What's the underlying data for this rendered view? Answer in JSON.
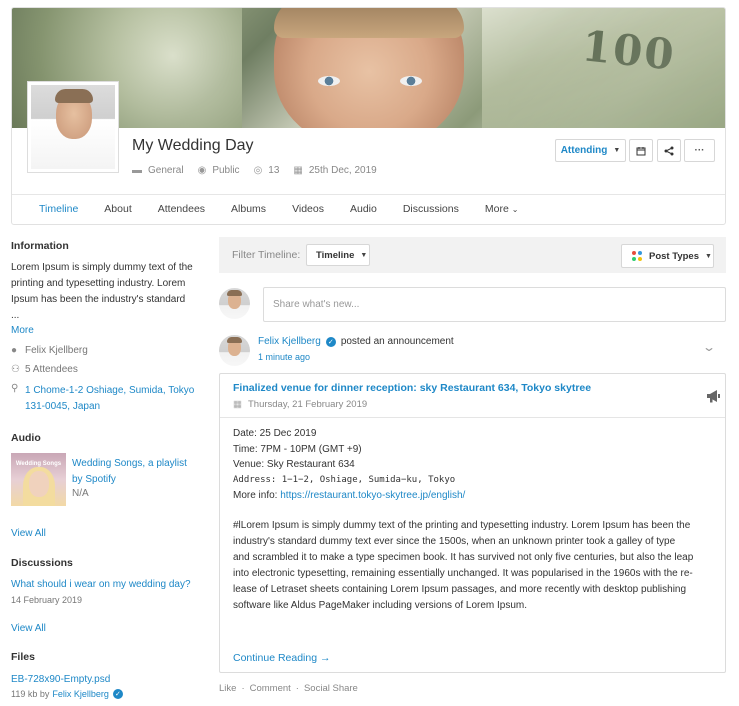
{
  "event": {
    "title": "My Wedding Day",
    "category": "General",
    "privacy": "Public",
    "views": "13",
    "date": "25th Dec, 2019"
  },
  "header_buttons": {
    "attending_label": "Attending",
    "more_label": "···"
  },
  "tabs": [
    "Timeline",
    "About",
    "Attendees",
    "Albums",
    "Videos",
    "Audio",
    "Discussions",
    "More"
  ],
  "sidebar": {
    "information": {
      "heading": "Information",
      "text_lines": [
        "Lorem Ipsum is simply dummy text of the",
        "printing and typesetting industry. Lorem",
        "Ipsum has been the industry's standard",
        "..."
      ],
      "more_link": "More",
      "host": "Felix Kjellberg",
      "attendees": "5 Attendees",
      "address_lines": [
        "1 Chome-1-2 Oshiage, Sumida, Tokyo",
        "131-0045, Japan"
      ]
    },
    "audio": {
      "heading": "Audio",
      "thumb_text": "Wedding Songs",
      "title_lines": [
        "Wedding Songs, a playlist",
        "by Spotify"
      ],
      "meta": "N/A",
      "view_all": "View All"
    },
    "discussions": {
      "heading": "Discussions",
      "title": "What should i wear on my wedding day?",
      "date": "14 February 2019",
      "view_all": "View All"
    },
    "files": {
      "heading": "Files",
      "file_name": "EB-728x90-Empty.psd",
      "meta_prefix": "119 kb by",
      "owner": "Felix Kjellberg"
    }
  },
  "filter": {
    "label": "Filter Timeline:",
    "selected": "Timeline",
    "post_types_label": "Post Types",
    "dot_colors": [
      "#e74c3c",
      "#3498db",
      "#2ecc71",
      "#f1c40f"
    ]
  },
  "composer": {
    "placeholder": "Share what's new..."
  },
  "post": {
    "author": "Felix Kjellberg",
    "action": "posted an announcement",
    "time": "1 minute ago",
    "announcement": {
      "title": "Finalized venue for dinner reception: sky Restaurant 634, Tokyo skytree",
      "date": "Thursday, 21 February 2019",
      "details": {
        "date_line": "Date: 25 Dec 2019",
        "time_line": "Time: 7PM - 10PM (GMT +9)",
        "venue_line": "Venue: Sky Restaurant 634",
        "address_line": "Address: 1−1−2, Oshiage, Sumida−ku, Tokyo",
        "more_info_prefix": "More info:",
        "more_info_link": "https://restaurant.tokyo-skytree.jp/english/"
      },
      "paragraph_lines": [
        "#lLorem Ipsum is simply dummy text of the printing and typesetting industry. Lorem Ipsum has been the",
        "industry's standard dummy text ever since the 1500s, when an unknown printer took a galley of type",
        "and scrambled it to make a type specimen book. It has survived not only five centuries, but also the leap",
        "into electronic typesetting, remaining essentially unchanged. It was popularised in the 1960s with the re-",
        "lease of Letraset sheets containing Lorem Ipsum passages, and more recently with desktop publishing",
        "software like Aldus PageMaker including versions of Lorem Ipsum."
      ],
      "continue_label": "Continue Reading →"
    },
    "actions": [
      "Like",
      "Comment",
      "Social Share"
    ]
  },
  "colors": {
    "accent": "#1e88c7",
    "muted": "#888888"
  }
}
